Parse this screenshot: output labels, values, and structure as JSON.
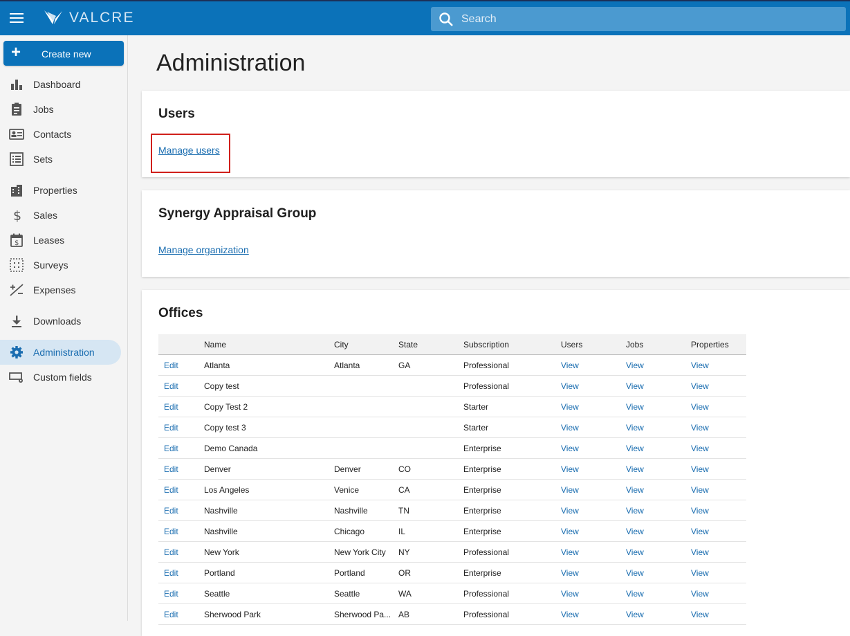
{
  "app": {
    "brand": "VALCRE"
  },
  "search": {
    "placeholder": "Search"
  },
  "sidebar": {
    "create_label": "Create new",
    "items": [
      {
        "label": "Dashboard"
      },
      {
        "label": "Jobs"
      },
      {
        "label": "Contacts"
      },
      {
        "label": "Sets"
      },
      {
        "label": "Properties"
      },
      {
        "label": "Sales"
      },
      {
        "label": "Leases"
      },
      {
        "label": "Surveys"
      },
      {
        "label": "Expenses"
      },
      {
        "label": "Downloads"
      },
      {
        "label": "Administration"
      },
      {
        "label": "Custom fields"
      }
    ]
  },
  "main": {
    "title": "Administration",
    "users_card": {
      "title": "Users",
      "link": "Manage users"
    },
    "org_card": {
      "title": "Synergy Appraisal Group",
      "link": "Manage organization"
    },
    "offices_card": {
      "title": "Offices",
      "columns": [
        "",
        "Name",
        "City",
        "State",
        "Subscription",
        "Users",
        "Jobs",
        "Properties"
      ],
      "rows": [
        {
          "edit": "Edit",
          "name": "Atlanta",
          "city": "Atlanta",
          "state": "GA",
          "subscription": "Professional",
          "users": "View",
          "jobs": "View",
          "properties": "View"
        },
        {
          "edit": "Edit",
          "name": "Copy test",
          "city": "",
          "state": "",
          "subscription": "Professional",
          "users": "View",
          "jobs": "View",
          "properties": "View"
        },
        {
          "edit": "Edit",
          "name": "Copy Test 2",
          "city": "",
          "state": "",
          "subscription": "Starter",
          "users": "View",
          "jobs": "View",
          "properties": "View"
        },
        {
          "edit": "Edit",
          "name": "Copy test 3",
          "city": "",
          "state": "",
          "subscription": "Starter",
          "users": "View",
          "jobs": "View",
          "properties": "View"
        },
        {
          "edit": "Edit",
          "name": "Demo Canada",
          "city": "",
          "state": "",
          "subscription": "Enterprise",
          "users": "View",
          "jobs": "View",
          "properties": "View"
        },
        {
          "edit": "Edit",
          "name": "Denver",
          "city": "Denver",
          "state": "CO",
          "subscription": "Enterprise",
          "users": "View",
          "jobs": "View",
          "properties": "View"
        },
        {
          "edit": "Edit",
          "name": "Los Angeles",
          "city": "Venice",
          "state": "CA",
          "subscription": "Enterprise",
          "users": "View",
          "jobs": "View",
          "properties": "View"
        },
        {
          "edit": "Edit",
          "name": "Nashville",
          "city": "Nashville",
          "state": "TN",
          "subscription": "Enterprise",
          "users": "View",
          "jobs": "View",
          "properties": "View"
        },
        {
          "edit": "Edit",
          "name": "Nashville",
          "city": "Chicago",
          "state": "IL",
          "subscription": "Enterprise",
          "users": "View",
          "jobs": "View",
          "properties": "View"
        },
        {
          "edit": "Edit",
          "name": "New York",
          "city": "New York City",
          "state": "NY",
          "subscription": "Professional",
          "users": "View",
          "jobs": "View",
          "properties": "View"
        },
        {
          "edit": "Edit",
          "name": "Portland",
          "city": "Portland",
          "state": "OR",
          "subscription": "Enterprise",
          "users": "View",
          "jobs": "View",
          "properties": "View"
        },
        {
          "edit": "Edit",
          "name": "Seattle",
          "city": "Seattle",
          "state": "WA",
          "subscription": "Professional",
          "users": "View",
          "jobs": "View",
          "properties": "View"
        },
        {
          "edit": "Edit",
          "name": "Sherwood Park",
          "city": "Sherwood Pa...",
          "state": "AB",
          "subscription": "Professional",
          "users": "View",
          "jobs": "View",
          "properties": "View"
        }
      ]
    }
  },
  "colors": {
    "brand_blue": "#0b72b9",
    "link_blue": "#1a6db0",
    "highlight_red": "#d0201b",
    "active_nav_bg": "#d6e6f3"
  }
}
